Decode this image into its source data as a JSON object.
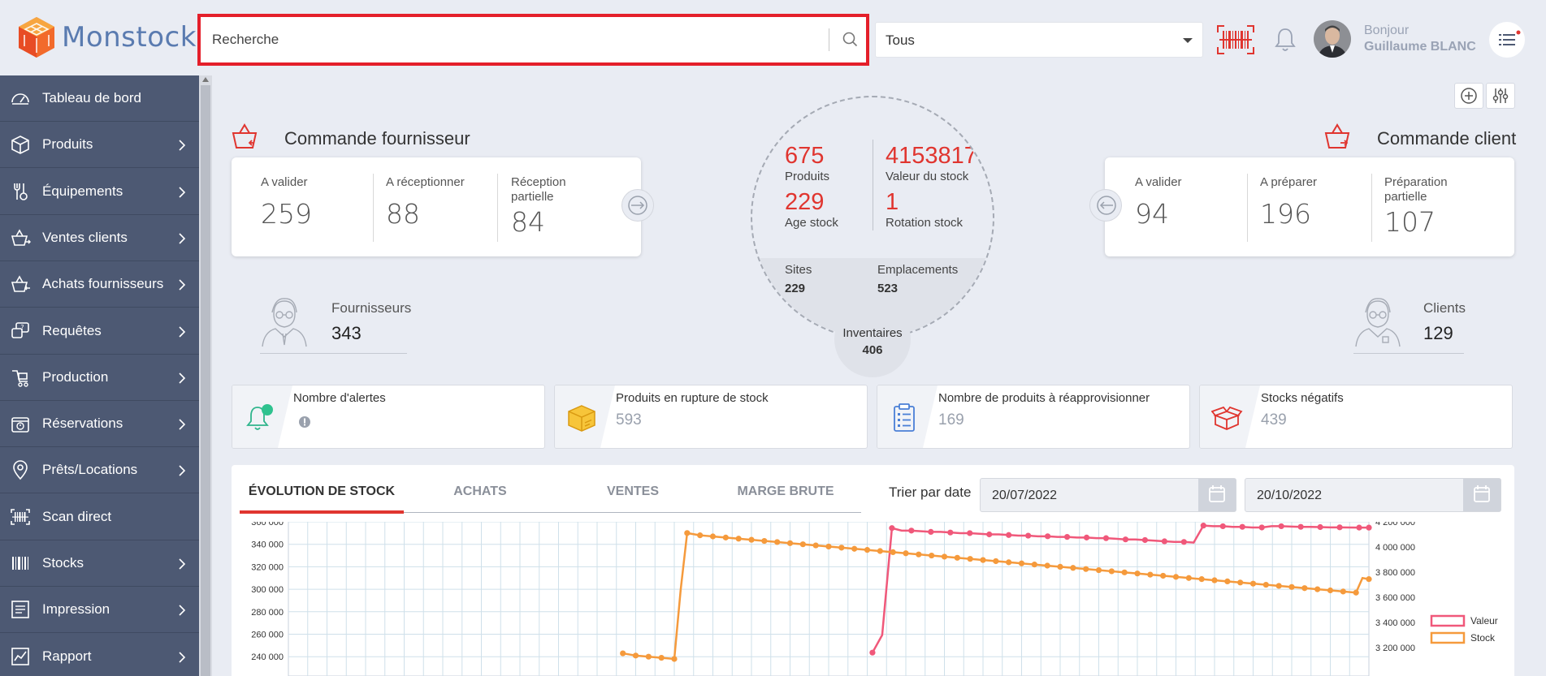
{
  "brand": {
    "name": "Monstock"
  },
  "search": {
    "value": "Recherche"
  },
  "scope_select": {
    "value": "Tous"
  },
  "user": {
    "greeting": "Bonjour",
    "name": "Guillaume BLANC"
  },
  "sidebar": {
    "items": [
      {
        "label": "Tableau de bord",
        "icon": "dashboard-icon",
        "chevron": false
      },
      {
        "label": "Produits",
        "icon": "box-icon",
        "chevron": true
      },
      {
        "label": "Équipements",
        "icon": "tools-icon",
        "chevron": true
      },
      {
        "label": "Ventes clients",
        "icon": "basket-out-icon",
        "chevron": true
      },
      {
        "label": "Achats fournisseurs",
        "icon": "basket-in-icon",
        "chevron": true
      },
      {
        "label": "Requêtes",
        "icon": "request-icon",
        "chevron": true
      },
      {
        "label": "Production",
        "icon": "production-icon",
        "chevron": true
      },
      {
        "label": "Réservations",
        "icon": "reservation-icon",
        "chevron": true
      },
      {
        "label": "Prêts/Locations",
        "icon": "location-pin-icon",
        "chevron": true
      },
      {
        "label": "Scan direct",
        "icon": "scan-icon",
        "chevron": false
      },
      {
        "label": "Stocks",
        "icon": "barcode-icon",
        "chevron": true
      },
      {
        "label": "Impression",
        "icon": "print-icon",
        "chevron": true
      },
      {
        "label": "Rapport",
        "icon": "report-icon",
        "chevron": true
      }
    ]
  },
  "supplier_orders": {
    "title": "Commande fournisseur",
    "stats": [
      {
        "label": "A valider",
        "value": "259"
      },
      {
        "label": "A réceptionner",
        "value": "88"
      },
      {
        "label": "Réception partielle",
        "value": "84"
      }
    ]
  },
  "client_orders": {
    "title": "Commande client",
    "stats": [
      {
        "label": "A valider",
        "value": "94"
      },
      {
        "label": "A préparer",
        "value": "196"
      },
      {
        "label": "Préparation partielle",
        "value": "107"
      }
    ]
  },
  "overview": {
    "products": {
      "value": "675",
      "label": "Produits"
    },
    "stock_value": {
      "value": "4153817",
      "label": "Valeur du stock"
    },
    "stock_age": {
      "value": "229",
      "label": "Age stock"
    },
    "stock_rotation": {
      "value": "1",
      "label": "Rotation stock"
    },
    "sites": {
      "label": "Sites",
      "value": "229"
    },
    "locations": {
      "label": "Emplacements",
      "value": "523"
    },
    "inventories": {
      "label": "Inventaires",
      "value": "406"
    }
  },
  "suppliers": {
    "label": "Fournisseurs",
    "value": "343"
  },
  "clients": {
    "label": "Clients",
    "value": "129"
  },
  "alerts": [
    {
      "title": "Nombre d'alertes",
      "value": ""
    },
    {
      "title": "Produits en rupture de stock",
      "value": "593"
    },
    {
      "title": "Nombre de produits à réapprovisionner",
      "value": "169"
    },
    {
      "title": "Stocks négatifs",
      "value": "439"
    }
  ],
  "chart_panel": {
    "tabs": [
      "ÉVOLUTION DE STOCK",
      "ACHATS",
      "VENTES",
      "MARGE BRUTE"
    ],
    "active_tab": 0,
    "sort_label": "Trier par date",
    "date_from": "20/07/2022",
    "date_to": "20/10/2022"
  },
  "chart_data": {
    "type": "line",
    "y_left_ticks": [
      "360 000",
      "340 000",
      "320 000",
      "300 000",
      "280 000",
      "260 000",
      "240 000"
    ],
    "y_left_range": [
      240000,
      360000
    ],
    "y_right_ticks": [
      "4 200 000",
      "4 000 000",
      "3 800 000",
      "3 600 000",
      "3 400 000",
      "3 200 000"
    ],
    "y_right_range": [
      3200000,
      4200000
    ],
    "grid": true,
    "legend_position": "right",
    "series": [
      {
        "name": "Valeur",
        "color": "#f0587a",
        "axis": "right",
        "values": [
          null,
          null,
          null,
          null,
          null,
          null,
          null,
          null,
          null,
          null,
          null,
          null,
          null,
          null,
          null,
          null,
          null,
          null,
          null,
          null,
          null,
          null,
          null,
          null,
          null,
          null,
          null,
          null,
          null,
          null,
          null,
          null,
          null,
          null,
          null,
          null,
          null,
          null,
          null,
          null,
          null,
          null,
          null,
          null,
          null,
          null,
          null,
          null,
          null,
          null,
          null,
          null,
          null,
          null,
          null,
          null,
          null,
          null,
          null,
          null,
          3160000,
          3300000,
          4150000,
          4130000,
          4130000,
          4125000,
          4120000,
          4120000,
          4115000,
          4110000,
          4110000,
          4105000,
          4100000,
          4100000,
          4095000,
          4090000,
          4090000,
          4085000,
          4085000,
          4080000,
          4080000,
          4075000,
          4075000,
          4070000,
          4070000,
          4065000,
          4060000,
          4060000,
          4055000,
          4050000,
          4045000,
          4040000,
          4040000,
          4035000,
          4170000,
          4165000,
          4165000,
          4160000,
          4160000,
          4155000,
          4155000,
          4165000,
          4165000,
          4162000,
          4160000,
          4160000,
          4158000,
          4156000,
          4156000,
          4155000,
          4154000,
          4153817
        ]
      },
      {
        "name": "Stock",
        "color": "#f59a3c",
        "axis": "left",
        "values": [
          null,
          null,
          null,
          null,
          null,
          null,
          null,
          null,
          null,
          null,
          null,
          null,
          null,
          null,
          null,
          null,
          null,
          null,
          null,
          null,
          null,
          null,
          null,
          null,
          null,
          null,
          null,
          null,
          null,
          null,
          null,
          null,
          null,
          null,
          null,
          null,
          null,
          null,
          null,
          null,
          null,
          null,
          null,
          null,
          null,
          null,
          null,
          null,
          null,
          null,
          null,
          null,
          243000,
          242000,
          241000,
          240500,
          240000,
          239500,
          239000,
          238500,
          238000,
          300000,
          350000,
          349000,
          348000,
          347500,
          347000,
          346500,
          346000,
          345500,
          345000,
          344500,
          344000,
          343500,
          343000,
          342500,
          342000,
          341500,
          341000,
          340500,
          340000,
          339500,
          339000,
          338500,
          338000,
          337500,
          337000,
          336500,
          336000,
          335500,
          335000,
          334500,
          334000,
          333500,
          333000,
          332500,
          332000,
          331500,
          331000,
          330500,
          330000,
          329500,
          329000,
          328500,
          328000,
          327500,
          327000,
          326500,
          326000,
          325500,
          325000,
          324500,
          324000,
          323500,
          323000,
          322500,
          322000,
          321500,
          321000,
          320500,
          320000,
          319500,
          319000,
          318500,
          318000,
          317500,
          317000,
          316500,
          316000,
          315500,
          315000,
          314500,
          314000,
          313500,
          313000,
          312500,
          312000,
          311500,
          311000,
          310500,
          310000,
          309500,
          309000,
          308500,
          308000,
          307500,
          307000,
          306500,
          306000,
          305500,
          305000,
          304500,
          304000,
          303500,
          303000,
          302500,
          302000,
          301500,
          301000,
          300500,
          300000,
          299500,
          299000,
          298500,
          298000,
          297500,
          297000,
          310000,
          309000
        ]
      }
    ],
    "legend": [
      "Valeur",
      "Stock"
    ]
  }
}
